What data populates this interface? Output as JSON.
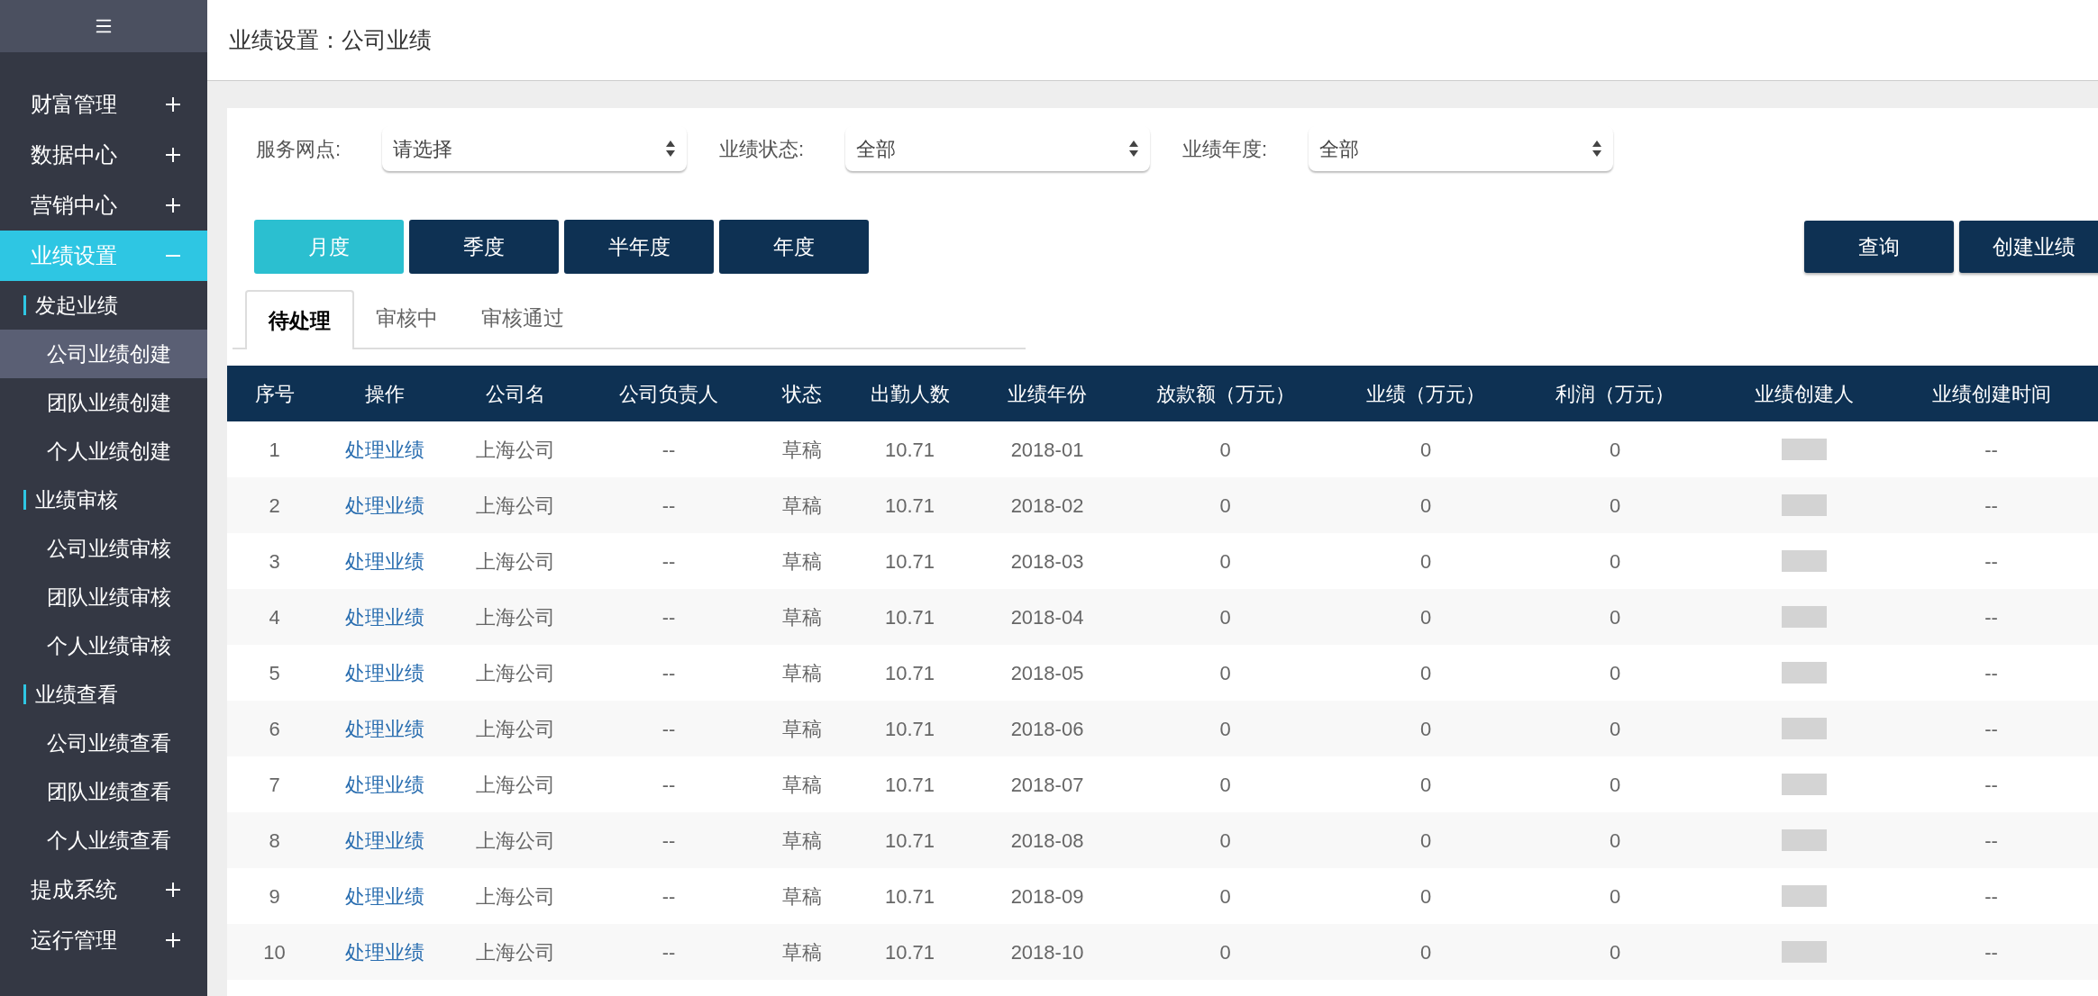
{
  "sidebar": {
    "items": [
      {
        "label": "财富管理",
        "expanded": false,
        "selected": false
      },
      {
        "label": "数据中心",
        "expanded": false,
        "selected": false
      },
      {
        "label": "营销中心",
        "expanded": false,
        "selected": false
      },
      {
        "label": "业绩设置",
        "expanded": true,
        "selected": true,
        "children": [
          {
            "label": "发起业绩",
            "children": [
              {
                "label": "公司业绩创建",
                "selected": true
              },
              {
                "label": "团队业绩创建",
                "selected": false
              },
              {
                "label": "个人业绩创建",
                "selected": false
              }
            ]
          },
          {
            "label": "业绩审核",
            "children": [
              {
                "label": "公司业绩审核",
                "selected": false
              },
              {
                "label": "团队业绩审核",
                "selected": false
              },
              {
                "label": "个人业绩审核",
                "selected": false
              }
            ]
          },
          {
            "label": "业绩查看",
            "children": [
              {
                "label": "公司业绩查看",
                "selected": false
              },
              {
                "label": "团队业绩查看",
                "selected": false
              },
              {
                "label": "个人业绩查看",
                "selected": false
              }
            ]
          }
        ]
      },
      {
        "label": "提成系统",
        "expanded": false,
        "selected": false
      },
      {
        "label": "运行管理",
        "expanded": false,
        "selected": false
      }
    ]
  },
  "page_title": "业绩设置：公司业绩",
  "filters": [
    {
      "label": "服务网点:",
      "value": "请选择"
    },
    {
      "label": "业绩状态:",
      "value": "全部"
    },
    {
      "label": "业绩年度:",
      "value": "全部"
    }
  ],
  "period_buttons": [
    {
      "label": "月度",
      "selected": true
    },
    {
      "label": "季度",
      "selected": false
    },
    {
      "label": "半年度",
      "selected": false
    },
    {
      "label": "年度",
      "selected": false
    }
  ],
  "action_buttons": [
    "查询",
    "创建业绩"
  ],
  "tabs": [
    {
      "label": "待处理",
      "selected": true
    },
    {
      "label": "审核中",
      "selected": false
    },
    {
      "label": "审核通过",
      "selected": false
    }
  ],
  "table": {
    "columns": [
      "序号",
      "操作",
      "公司名",
      "公司负责人",
      "状态",
      "出勤人数",
      "业绩年份",
      "放款额（万元）",
      "业绩（万元）",
      "利润（万元）",
      "业绩创建人",
      "业绩创建时间"
    ],
    "rows": [
      [
        "1",
        "处理业绩",
        "上海公司",
        "--",
        "草稿",
        "10.71",
        "2018-01",
        "0",
        "0",
        "0",
        null,
        "--"
      ],
      [
        "2",
        "处理业绩",
        "上海公司",
        "--",
        "草稿",
        "10.71",
        "2018-02",
        "0",
        "0",
        "0",
        null,
        "--"
      ],
      [
        "3",
        "处理业绩",
        "上海公司",
        "--",
        "草稿",
        "10.71",
        "2018-03",
        "0",
        "0",
        "0",
        null,
        "--"
      ],
      [
        "4",
        "处理业绩",
        "上海公司",
        "--",
        "草稿",
        "10.71",
        "2018-04",
        "0",
        "0",
        "0",
        null,
        "--"
      ],
      [
        "5",
        "处理业绩",
        "上海公司",
        "--",
        "草稿",
        "10.71",
        "2018-05",
        "0",
        "0",
        "0",
        null,
        "--"
      ],
      [
        "6",
        "处理业绩",
        "上海公司",
        "--",
        "草稿",
        "10.71",
        "2018-06",
        "0",
        "0",
        "0",
        null,
        "--"
      ],
      [
        "7",
        "处理业绩",
        "上海公司",
        "--",
        "草稿",
        "10.71",
        "2018-07",
        "0",
        "0",
        "0",
        null,
        "--"
      ],
      [
        "8",
        "处理业绩",
        "上海公司",
        "--",
        "草稿",
        "10.71",
        "2018-08",
        "0",
        "0",
        "0",
        null,
        "--"
      ],
      [
        "9",
        "处理业绩",
        "上海公司",
        "--",
        "草稿",
        "10.71",
        "2018-09",
        "0",
        "0",
        "0",
        null,
        "--"
      ],
      [
        "10",
        "处理业绩",
        "上海公司",
        "--",
        "草稿",
        "10.71",
        "2018-10",
        "0",
        "0",
        "0",
        null,
        "--"
      ]
    ]
  }
}
